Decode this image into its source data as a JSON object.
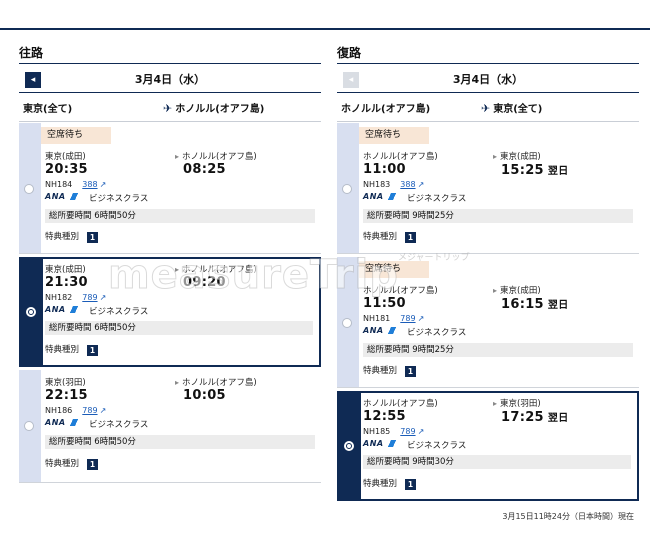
{
  "outbound": {
    "heading": "往路",
    "nav": "◂",
    "date": "3月4日（水）",
    "from": "東京(全て)",
    "to": "ホノルル(オアフ島)",
    "flights": [
      {
        "waitlist": "空席待ち",
        "dep_city": "東京(成田)",
        "dep_time": "20:35",
        "arr_city": "ホノルル(オアフ島)",
        "arr_time": "08:25",
        "next_day": "",
        "flight_no": "NH184",
        "aircraft": "388",
        "airline": "ANA",
        "cabin": "ビジネスクラス",
        "duration": "総所要時間 6時間50分",
        "award_label": "特典種別",
        "award_type": "1"
      },
      {
        "waitlist": "",
        "dep_city": "東京(成田)",
        "dep_time": "21:30",
        "arr_city": "ホノルル(オアフ島)",
        "arr_time": "09:20",
        "next_day": "",
        "flight_no": "NH182",
        "aircraft": "789",
        "airline": "ANA",
        "cabin": "ビジネスクラス",
        "duration": "総所要時間 6時間50分",
        "award_label": "特典種別",
        "award_type": "1"
      },
      {
        "waitlist": "",
        "dep_city": "東京(羽田)",
        "dep_time": "22:15",
        "arr_city": "ホノルル(オアフ島)",
        "arr_time": "10:05",
        "next_day": "",
        "flight_no": "NH186",
        "aircraft": "789",
        "airline": "ANA",
        "cabin": "ビジネスクラス",
        "duration": "総所要時間 6時間50分",
        "award_label": "特典種別",
        "award_type": "1"
      }
    ]
  },
  "return": {
    "heading": "復路",
    "nav": "◂",
    "date": "3月4日（水）",
    "from": "ホノルル(オアフ島)",
    "to": "東京(全て)",
    "flights": [
      {
        "waitlist": "空席待ち",
        "dep_city": "ホノルル(オアフ島)",
        "dep_time": "11:00",
        "arr_city": "東京(成田)",
        "arr_time": "15:25",
        "next_day": "翌日",
        "flight_no": "NH183",
        "aircraft": "388",
        "airline": "ANA",
        "cabin": "ビジネスクラス",
        "duration": "総所要時間 9時間25分",
        "award_label": "特典種別",
        "award_type": "1"
      },
      {
        "waitlist": "空席待ち",
        "dep_city": "ホノルル(オアフ島)",
        "dep_time": "11:50",
        "arr_city": "東京(成田)",
        "arr_time": "16:15",
        "next_day": "翌日",
        "flight_no": "NH181",
        "aircraft": "789",
        "airline": "ANA",
        "cabin": "ビジネスクラス",
        "duration": "総所要時間 9時間25分",
        "award_label": "特典種別",
        "award_type": "1"
      },
      {
        "waitlist": "",
        "dep_city": "ホノルル(オアフ島)",
        "dep_time": "12:55",
        "arr_city": "東京(羽田)",
        "arr_time": "17:25",
        "next_day": "翌日",
        "flight_no": "NH185",
        "aircraft": "789",
        "airline": "ANA",
        "cabin": "ビジネスクラス",
        "duration": "総所要時間 9時間30分",
        "award_label": "特典種別",
        "award_type": "1"
      }
    ]
  },
  "watermark": "measureTrip",
  "watermark_sub": "メジャートリップ",
  "timestamp": "3月15日11時24分（日本時間）現在",
  "colors": {
    "navy": "#0f2a54",
    "rail": "#d8dff0",
    "waitlist_bg": "#f8e6d6",
    "link": "#1a5cb8"
  }
}
